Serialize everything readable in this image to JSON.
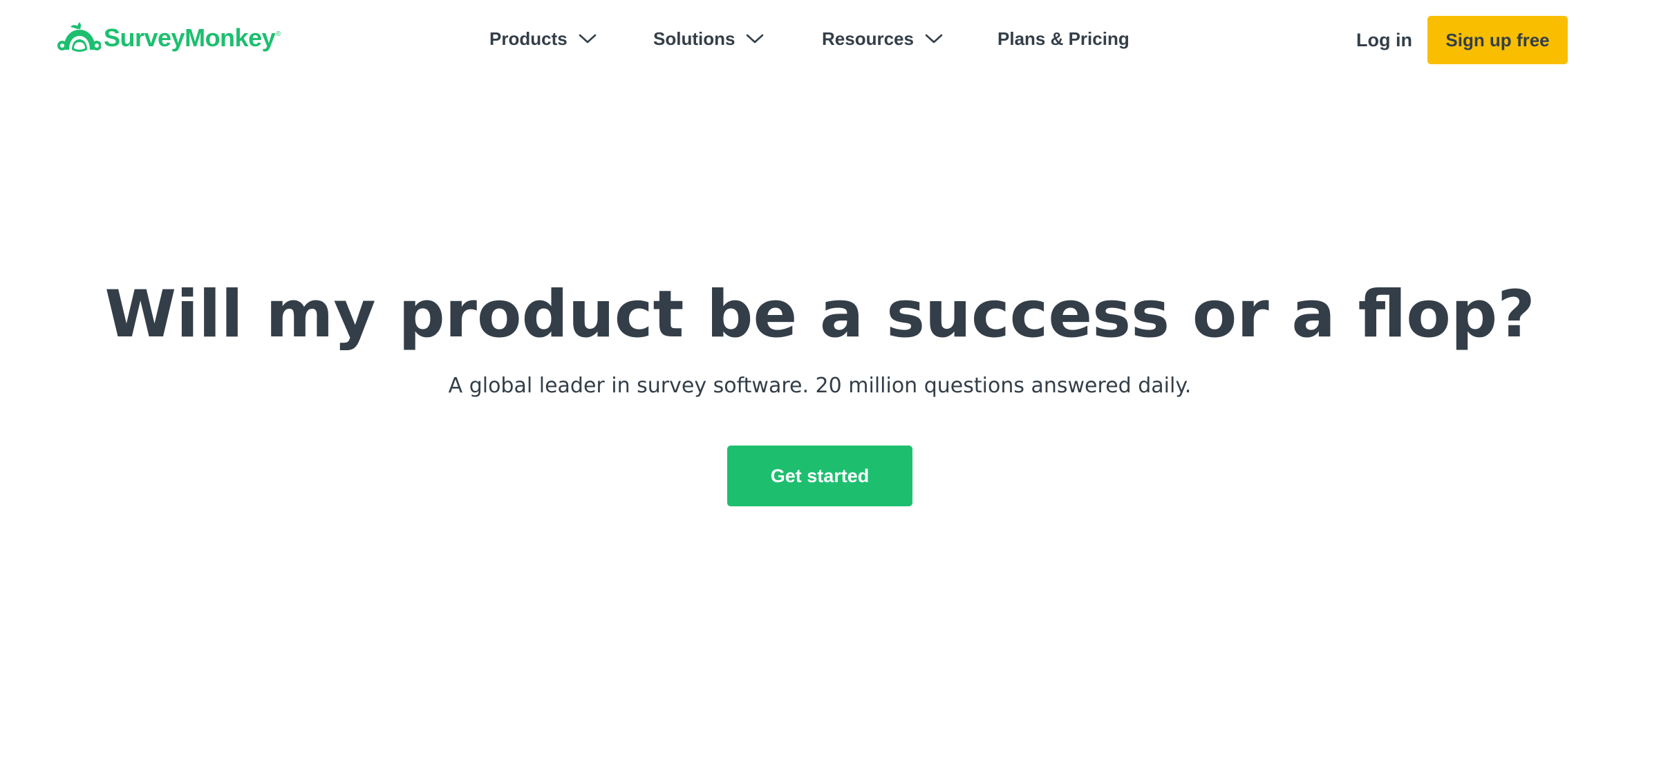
{
  "brand": {
    "name": "SurveyMonkey",
    "registered_mark": "®",
    "logo_icon": "monkey-head-logo-icon",
    "color": "#1dbf6f"
  },
  "nav": {
    "items": [
      {
        "label": "Products",
        "has_dropdown": true,
        "icon": "chevron-down-icon"
      },
      {
        "label": "Solutions",
        "has_dropdown": true,
        "icon": "chevron-down-icon"
      },
      {
        "label": "Resources",
        "has_dropdown": true,
        "icon": "chevron-down-icon"
      },
      {
        "label": "Plans & Pricing",
        "has_dropdown": false
      }
    ]
  },
  "auth": {
    "login_label": "Log in",
    "signup_label": "Sign up free",
    "signup_color": "#f9be00"
  },
  "hero": {
    "title": "Will my product be a success or a flop?",
    "subtitle": "A global leader in survey software. 20 million questions answered daily.",
    "cta_label": "Get started",
    "cta_color": "#1dbf6f"
  },
  "colors": {
    "text": "#333e48",
    "background": "#ffffff"
  }
}
